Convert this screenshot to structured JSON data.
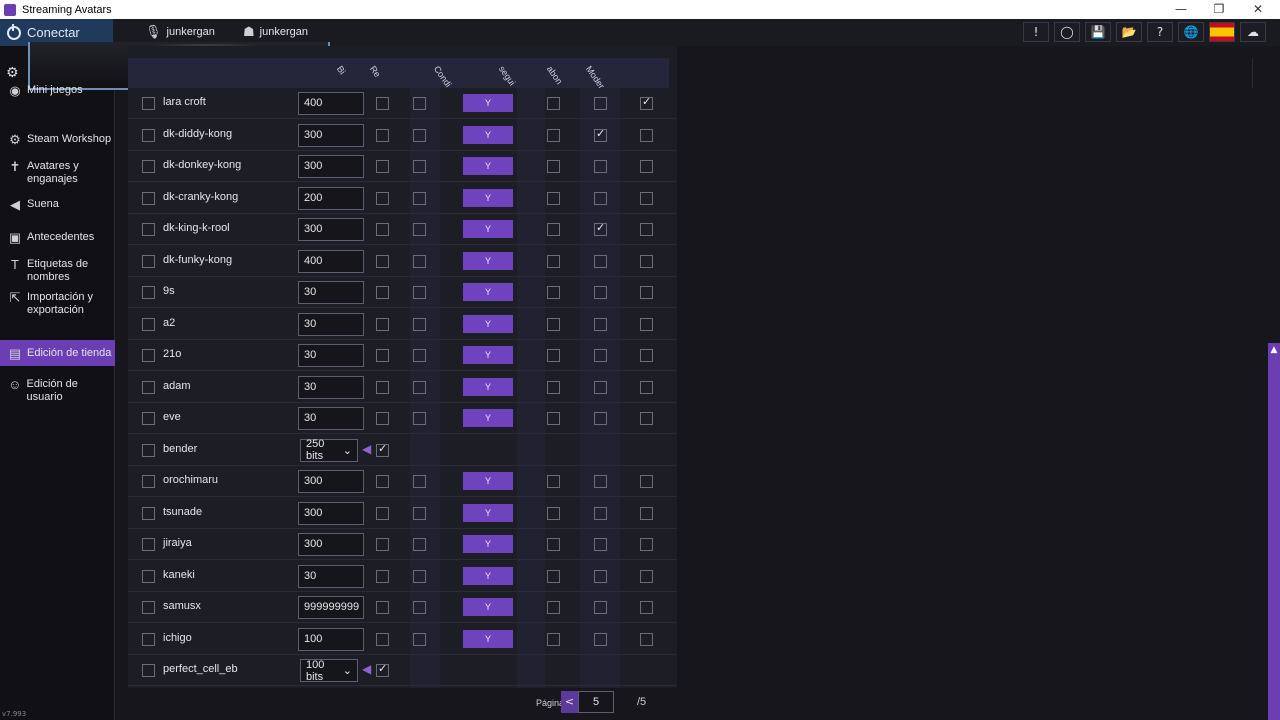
{
  "window": {
    "title": "Streaming Avatars",
    "controls": [
      "—",
      "❐",
      "✕"
    ]
  },
  "topbar": {
    "connect_label": "Conectar",
    "user1": "junkergan",
    "user2": "junkergan",
    "tools": [
      "!",
      "◯",
      "💾",
      "📂",
      "?",
      "🌐",
      "",
      "☁"
    ]
  },
  "sidebar": {
    "items": [
      {
        "icon": "gamepad-icon",
        "glyph": "◉",
        "label": "Mini juegos"
      },
      {
        "icon": "steam-icon",
        "glyph": "⚙",
        "label": "Steam Workshop"
      },
      {
        "icon": "figure-icon",
        "glyph": "✝",
        "label": "Avatares y\nenganajes"
      },
      {
        "icon": "speaker-icon",
        "glyph": "◀",
        "label": "Suena"
      },
      {
        "icon": "image-icon",
        "glyph": "▣",
        "label": "Antecedentes"
      },
      {
        "icon": "text-icon",
        "glyph": "T",
        "label": "Etiquetas de\nnombres"
      },
      {
        "icon": "export-icon",
        "glyph": "⇱",
        "label": "Importación y\nexportación"
      },
      {
        "icon": "store-icon",
        "glyph": "▤",
        "label": "Edición de tienda"
      },
      {
        "icon": "user-icon",
        "glyph": "☺",
        "label": "Edición de usuario"
      }
    ],
    "version": "v7.993"
  },
  "columns": [
    "Bi",
    "Re",
    "Condi",
    "segui",
    "abon",
    "Moder"
  ],
  "rows": [
    {
      "name": "lara croft",
      "price": "400",
      "type": "input",
      "c1": false,
      "c2": false,
      "y": "Y",
      "c3": false,
      "c4": false,
      "c5": true
    },
    {
      "name": "dk-diddy-kong",
      "price": "300",
      "type": "input",
      "c1": false,
      "c2": false,
      "y": "Y",
      "c3": false,
      "c4": true,
      "c5": false
    },
    {
      "name": "dk-donkey-kong",
      "price": "300",
      "type": "input",
      "c1": false,
      "c2": false,
      "y": "Y",
      "c3": false,
      "c4": false,
      "c5": false
    },
    {
      "name": "dk-cranky-kong",
      "price": "200",
      "type": "input",
      "c1": false,
      "c2": false,
      "y": "Y",
      "c3": false,
      "c4": false,
      "c5": false
    },
    {
      "name": "dk-king-k-rool",
      "price": "300",
      "type": "input",
      "c1": false,
      "c2": false,
      "y": "Y",
      "c3": false,
      "c4": true,
      "c5": false
    },
    {
      "name": "dk-funky-kong",
      "price": "400",
      "type": "input",
      "c1": false,
      "c2": false,
      "y": "Y",
      "c3": false,
      "c4": false,
      "c5": false
    },
    {
      "name": "9s",
      "price": "30",
      "type": "input",
      "c1": false,
      "c2": false,
      "y": "Y",
      "c3": false,
      "c4": false,
      "c5": false
    },
    {
      "name": "a2",
      "price": "30",
      "type": "input",
      "c1": false,
      "c2": false,
      "y": "Y",
      "c3": false,
      "c4": false,
      "c5": false
    },
    {
      "name": "21o",
      "price": "30",
      "type": "input",
      "c1": false,
      "c2": false,
      "y": "Y",
      "c3": false,
      "c4": false,
      "c5": false
    },
    {
      "name": "adam",
      "price": "30",
      "type": "input",
      "c1": false,
      "c2": false,
      "y": "Y",
      "c3": false,
      "c4": false,
      "c5": false
    },
    {
      "name": "eve",
      "price": "30",
      "type": "input",
      "c1": false,
      "c2": false,
      "y": "Y",
      "c3": false,
      "c4": false,
      "c5": false
    },
    {
      "name": "bender",
      "price": "250 bits",
      "type": "select",
      "c1": true
    },
    {
      "name": "orochimaru",
      "price": "300",
      "type": "input",
      "c1": false,
      "c2": false,
      "y": "Y",
      "c3": false,
      "c4": false,
      "c5": false
    },
    {
      "name": "tsunade",
      "price": "300",
      "type": "input",
      "c1": false,
      "c2": false,
      "y": "Y",
      "c3": false,
      "c4": false,
      "c5": false
    },
    {
      "name": "jiraiya",
      "price": "300",
      "type": "input",
      "c1": false,
      "c2": false,
      "y": "Y",
      "c3": false,
      "c4": false,
      "c5": false
    },
    {
      "name": "kaneki",
      "price": "30",
      "type": "input",
      "c1": false,
      "c2": false,
      "y": "Y",
      "c3": false,
      "c4": false,
      "c5": false
    },
    {
      "name": "samusx",
      "price": "999999999",
      "type": "input",
      "c1": false,
      "c2": false,
      "y": "Y",
      "c3": false,
      "c4": false,
      "c5": false
    },
    {
      "name": "ichigo",
      "price": "100",
      "type": "input",
      "c1": false,
      "c2": false,
      "y": "Y",
      "c3": false,
      "c4": false,
      "c5": false
    },
    {
      "name": "perfect_cell_eb",
      "price": "100 bits",
      "type": "select",
      "c1": true
    }
  ],
  "pager": {
    "label": "Página:",
    "prev": "<",
    "current": "5",
    "total": "/5"
  },
  "colors": {
    "accent": "#6b3fb3",
    "button": "#6f43bd"
  }
}
